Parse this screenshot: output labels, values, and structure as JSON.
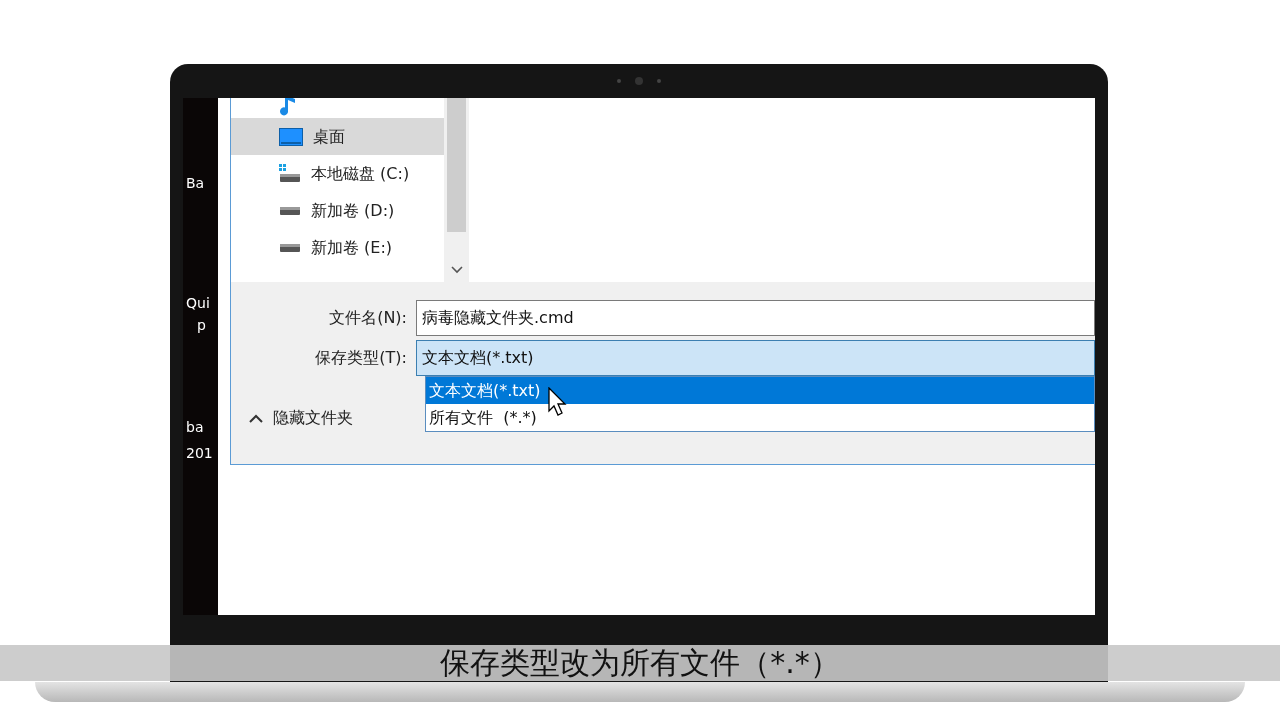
{
  "desktop_icons": [
    {
      "label": "Ba"
    },
    {
      "label": "Qui"
    },
    {
      "label": "p"
    },
    {
      "label": "ba"
    },
    {
      "label": "201"
    }
  ],
  "nav_pane": {
    "items": [
      {
        "kind": "music",
        "selected": false
      },
      {
        "kind": "desktop",
        "label": "桌面",
        "selected": true
      },
      {
        "kind": "system_drive",
        "label": "本地磁盘 (C:)",
        "selected": false
      },
      {
        "kind": "drive",
        "label": "新加卷 (D:)",
        "selected": false
      },
      {
        "kind": "drive",
        "label": "新加卷 (E:)",
        "selected": false
      }
    ]
  },
  "file_name": {
    "label": "文件名(N):",
    "value": "病毒隐藏文件夹.cmd"
  },
  "save_type": {
    "label": "保存类型(T):",
    "value": "文本文档(*.txt)",
    "expanded": true,
    "options": [
      {
        "label": "文本文档(*.txt)",
        "selected": true
      },
      {
        "label": "所有文件  (*.*)",
        "selected": false
      }
    ]
  },
  "hide_folders": {
    "label": "隐藏文件夹"
  },
  "subtitle": "保存类型改为所有文件（*.*）"
}
